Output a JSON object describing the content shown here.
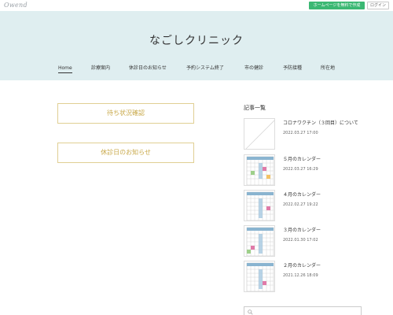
{
  "topbar": {
    "logo": "Owend",
    "cta_label": "ホームページを無料で作成",
    "login_label": "ログイン"
  },
  "header": {
    "site_title": "なごしクリニック",
    "nav": [
      {
        "label": "Home",
        "active": true
      },
      {
        "label": "診療案内",
        "active": false
      },
      {
        "label": "休診日のお知らせ",
        "active": false
      },
      {
        "label": "予約システム終了",
        "active": false
      },
      {
        "label": "市の健診",
        "active": false
      },
      {
        "label": "予防接種",
        "active": false
      },
      {
        "label": "所在地",
        "active": false
      }
    ]
  },
  "main": {
    "buttons": [
      {
        "label": "待ち状況確認"
      },
      {
        "label": "休診日のお知らせ"
      }
    ]
  },
  "sidebar": {
    "title": "記事一覧",
    "posts": [
      {
        "title": "コロナワクチン（３回目）について",
        "date": "2022.03.27 17:00",
        "thumb": "placeholder"
      },
      {
        "title": "５月のカレンダー",
        "date": "2022.03.27 16:29",
        "thumb": "calendar"
      },
      {
        "title": "４月のカレンダー",
        "date": "2022.02.27 19:22",
        "thumb": "calendar"
      },
      {
        "title": "３月のカレンダー",
        "date": "2022.01.30 17:02",
        "thumb": "calendar"
      },
      {
        "title": "２月のカレンダー",
        "date": "2021.12.26 18:09",
        "thumb": "calendar"
      }
    ],
    "search_icon": "search-icon"
  },
  "colors": {
    "header_bg": "#dfeef0",
    "cta_green": "#3bb873",
    "button_border": "#e0cf93",
    "button_text": "#c9a94a"
  }
}
